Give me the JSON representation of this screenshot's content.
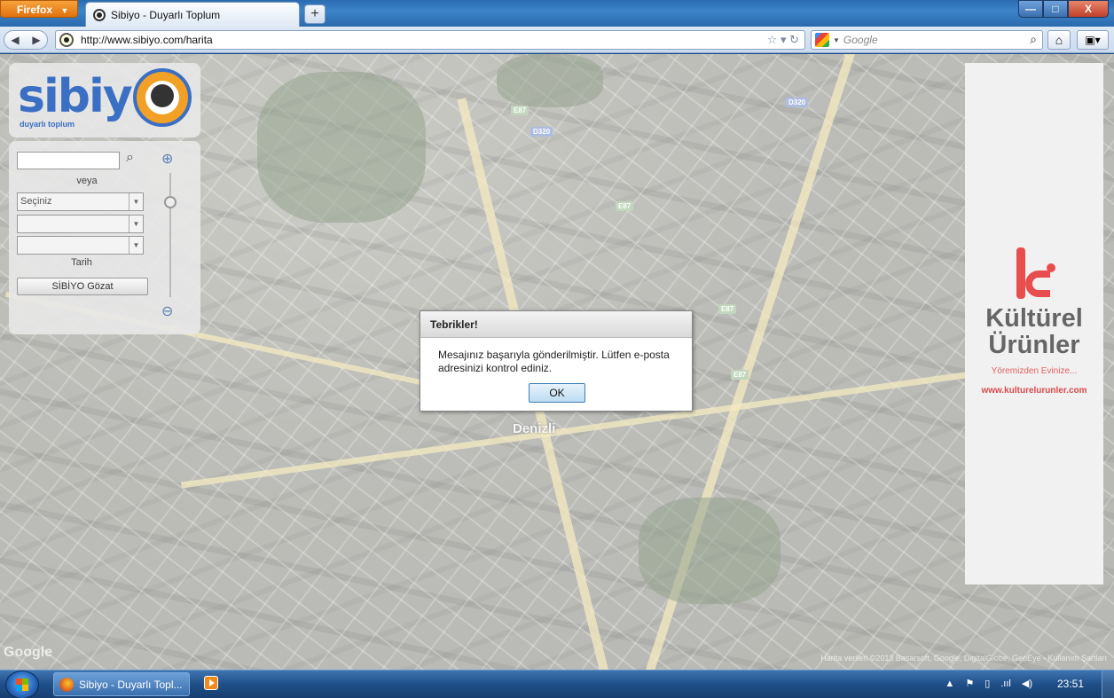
{
  "browser": {
    "app_menu_label": "Firefox",
    "tab_title": "Sibiyo - Duyarlı Toplum",
    "new_tab_label": "+",
    "url": "http://www.sibiyo.com/harita",
    "search_placeholder": "Google",
    "window_controls": {
      "minimize": "—",
      "maximize": "□",
      "close": "X"
    }
  },
  "map": {
    "labels": [
      {
        "text": "Denizli"
      },
      {
        "text": "E87"
      },
      {
        "text": "D320"
      },
      {
        "text": "E87"
      },
      {
        "text": "D320"
      },
      {
        "text": "E87"
      },
      {
        "text": "E87"
      }
    ],
    "attribution": "Harita verileri ©2013 Basarsoft, Google, DigitalGlobe, GeoEye - Kullanım Şartları",
    "google_logo": "Google"
  },
  "sidebar": {
    "logo_text": "sibiy",
    "logo_tagline": "duyarlı toplum",
    "search_input_value": "",
    "or_label": "veya",
    "select_1_value": "Seçiniz",
    "select_2_value": "",
    "select_3_value": "",
    "date_label": "Tarih",
    "browse_button": "SİBİYO Gözat"
  },
  "ad": {
    "title_line1": "Kültürel",
    "title_line2": "Ürünler",
    "subtitle": "Yöremizden Evinize...",
    "url": "www.kulturelurunler.com"
  },
  "dialog": {
    "title": "Tebrikler!",
    "message": "Mesajınız başarıyla gönderilmiştir. Lütfen e-posta adresinizi kontrol ediniz.",
    "ok_label": "OK"
  },
  "taskbar": {
    "firefox_task_label": "Sibiyo - Duyarlı Topl...",
    "clock": "23:51",
    "tray_items": [
      "▲",
      "⚑",
      "▯",
      ".ııl",
      "◀)"
    ]
  }
}
